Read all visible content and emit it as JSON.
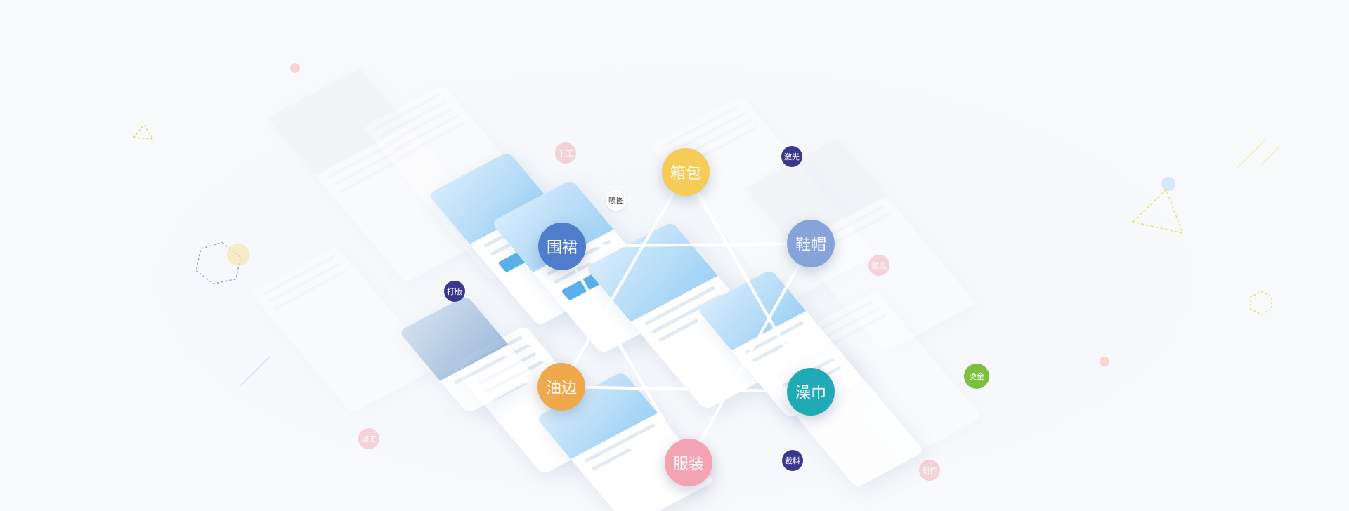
{
  "hub_nodes": [
    {
      "id": "bags",
      "label": "箱包",
      "color": "#f6cc59"
    },
    {
      "id": "apron",
      "label": "围裙",
      "color": "#4f7ccb"
    },
    {
      "id": "hats",
      "label": "鞋帽",
      "color": "#86a4d9"
    },
    {
      "id": "edge",
      "label": "油边",
      "color": "#f0a94a"
    },
    {
      "id": "towel",
      "label": "澡巾",
      "color": "#1faab6"
    },
    {
      "id": "apparel",
      "label": "服装",
      "color": "#f3a3b2"
    }
  ],
  "tag_nodes": [
    {
      "id": "handmade",
      "label": "手工",
      "color": "#f3a3b2"
    },
    {
      "id": "laser1",
      "label": "激光",
      "color": "#3a3790"
    },
    {
      "id": "spray",
      "label": "喷图",
      "color": "#ffffff"
    },
    {
      "id": "pattern",
      "label": "打版",
      "color": "#3a3790"
    },
    {
      "id": "laser2",
      "label": "激光",
      "color": "#f3a3b2"
    },
    {
      "id": "gilding",
      "label": "烫金",
      "color": "#7cbf3f"
    },
    {
      "id": "cutting",
      "label": "裁料",
      "color": "#3a3790"
    },
    {
      "id": "processing",
      "label": "加工",
      "color": "#f3a3b2"
    },
    {
      "id": "making",
      "label": "制作",
      "color": "#f3a3b2"
    }
  ],
  "colors": {
    "background": "#f8f9fb",
    "line": "#ffffff",
    "accent_blue": "#5ab0ea"
  }
}
